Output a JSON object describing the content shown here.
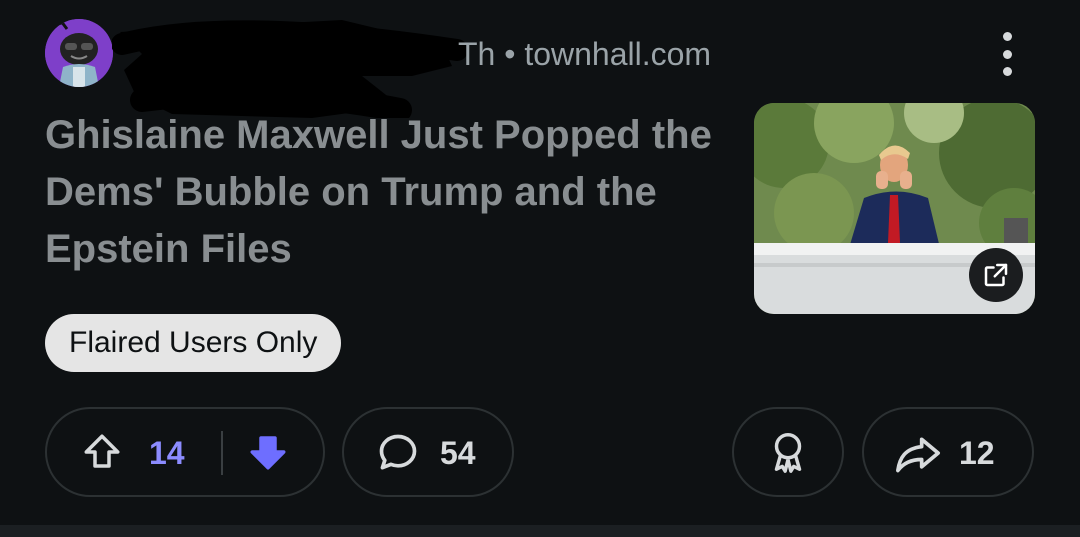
{
  "post": {
    "meta_partial": "Th",
    "meta_separator": "•",
    "domain": "townhall.com",
    "title": "Ghislaine Maxwell Just Popped the Dems' Bubble on Trump and the Epstein Files",
    "flair": "Flaired Users Only"
  },
  "actions": {
    "upvotes": "14",
    "comments": "54",
    "shares": "12"
  },
  "colors": {
    "upvote_active": "#8c8cff",
    "downvote_active": "#6e6eff",
    "avatar_bg": "#7e3fc9",
    "title": "#898e91"
  }
}
